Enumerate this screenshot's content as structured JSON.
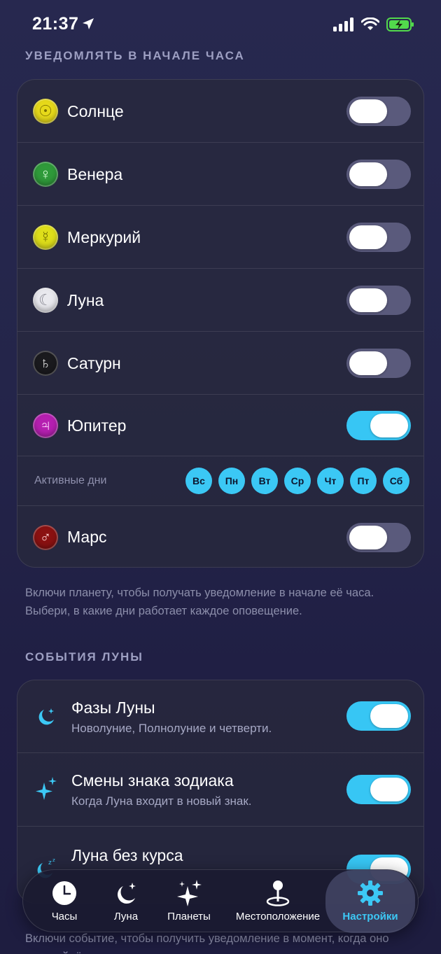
{
  "status": {
    "time": "21:37"
  },
  "hour_notify": {
    "header": "УВЕДОМЛЯТЬ В НАЧАЛЕ ЧАСА",
    "planets": [
      {
        "name": "Солнце",
        "glyph": "☉",
        "color": "#e6d91a",
        "glyph_color": "#7a6f00",
        "on": false
      },
      {
        "name": "Венера",
        "glyph": "♀",
        "color": "#2f9a3a",
        "glyph_color": "#d8ffd8",
        "on": false
      },
      {
        "name": "Меркурий",
        "glyph": "☿",
        "color": "#dede1a",
        "glyph_color": "#6f6c00",
        "on": false
      },
      {
        "name": "Луна",
        "glyph": "☾",
        "color": "#e9e9ee",
        "glyph_color": "#8a8a94",
        "on": false
      },
      {
        "name": "Сатурн",
        "glyph": "♄",
        "color": "#1a1a1e",
        "glyph_color": "#e6e6e6",
        "on": false
      },
      {
        "name": "Юпитер",
        "glyph": "♃",
        "color": "#b51fb0",
        "glyph_color": "#ffd9ff",
        "on": true
      }
    ],
    "active_days": {
      "label": "Активные дни",
      "days": [
        "Вс",
        "Пн",
        "Вт",
        "Ср",
        "Чт",
        "Пт",
        "Сб"
      ]
    },
    "mars": {
      "name": "Марс",
      "glyph": "♂",
      "color": "#8a1111",
      "glyph_color": "#ffd0d0",
      "on": false
    },
    "footnote": "Включи планету, чтобы получать уведомление в начале её часа. Выбери, в какие дни работает каждое оповещение."
  },
  "moon_events": {
    "header": "СОБЫТИЯ ЛУНЫ",
    "items": [
      {
        "title": "Фазы Луны",
        "subtitle": "Новолуние, Полнолуние и четверти.",
        "icon": "moon-stars-icon",
        "on": true
      },
      {
        "title": "Смены знака зодиака",
        "subtitle": "Когда Луна входит в новый знак.",
        "icon": "sparkles-icon",
        "on": true
      },
      {
        "title": "Луна без курса",
        "subtitle": "",
        "icon": "moon-zzz-icon",
        "on": true
      }
    ],
    "footnote": "Включи событие, чтобы получить уведомление в момент, когда оно произойдёт."
  },
  "tabs": [
    {
      "label": "Часы",
      "icon": "clock-icon",
      "active": false
    },
    {
      "label": "Луна",
      "icon": "moon-stars-icon",
      "active": false
    },
    {
      "label": "Планеты",
      "icon": "sparkles-icon",
      "active": false
    },
    {
      "label": "Местоположение",
      "icon": "map-pin-icon",
      "active": false
    },
    {
      "label": "Настройки",
      "icon": "gear-icon",
      "active": true
    }
  ],
  "colors": {
    "accent": "#37c6f4",
    "toggle_off": "#5a5a7c"
  }
}
